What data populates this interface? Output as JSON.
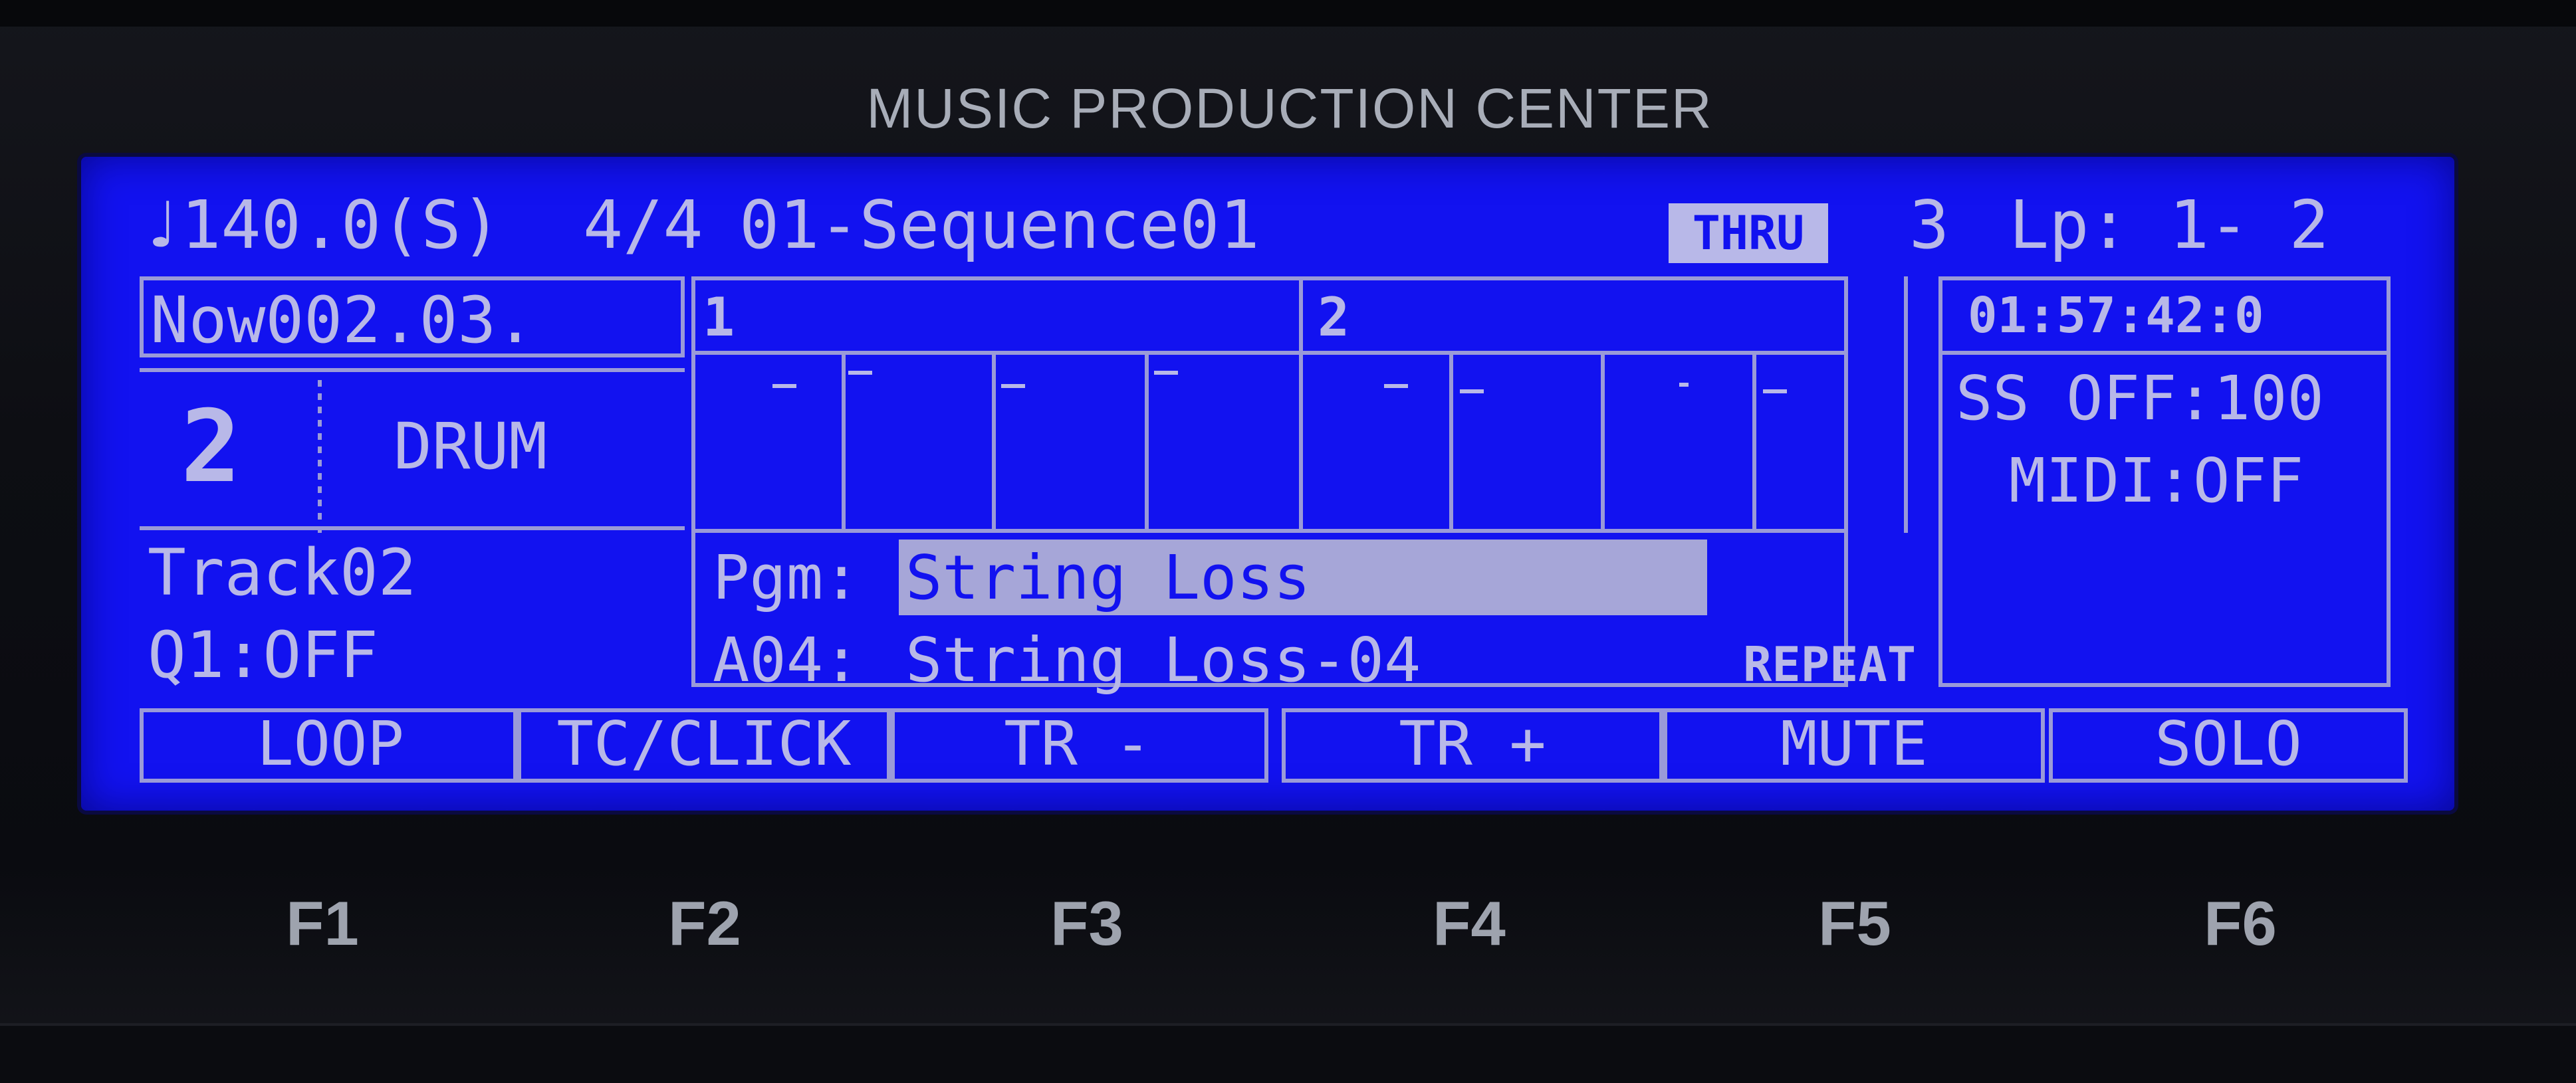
{
  "device": {
    "brand": "MUSIC PRODUCTION CENTER"
  },
  "header": {
    "tempo": "♩140.0(S)",
    "time_signature": "4/4",
    "sequence": "01-Sequence01",
    "thru_badge": "THRU",
    "count": "3",
    "loop_range": "Lp: 1- 2"
  },
  "left": {
    "now": "Now002.03.",
    "track_number": "2",
    "track_type": "DRUM",
    "track_name": "Track02",
    "quantize": "Q1:OFF"
  },
  "grid": {
    "bar_labels": [
      "1",
      "2"
    ]
  },
  "program": {
    "pgm_label": "Pgm:",
    "pgm_value": "String Loss",
    "pad_label": "A04:",
    "pad_value": "String Loss-04",
    "repeat": "REPEAT"
  },
  "right": {
    "timecode": "01:57:42:0",
    "ss": "SS OFF:100",
    "midi": "MIDI:OFF"
  },
  "softkeys": [
    "LOOP",
    "TC/CLICK",
    "TR -",
    "TR +",
    "MUTE",
    "SOLO"
  ],
  "fkeys": [
    "F1",
    "F2",
    "F3",
    "F4",
    "F5",
    "F6"
  ],
  "colors": {
    "lcd_background": "#1212f0",
    "lcd_text": "#b8b8e8",
    "bezel": "#0c0d12"
  }
}
